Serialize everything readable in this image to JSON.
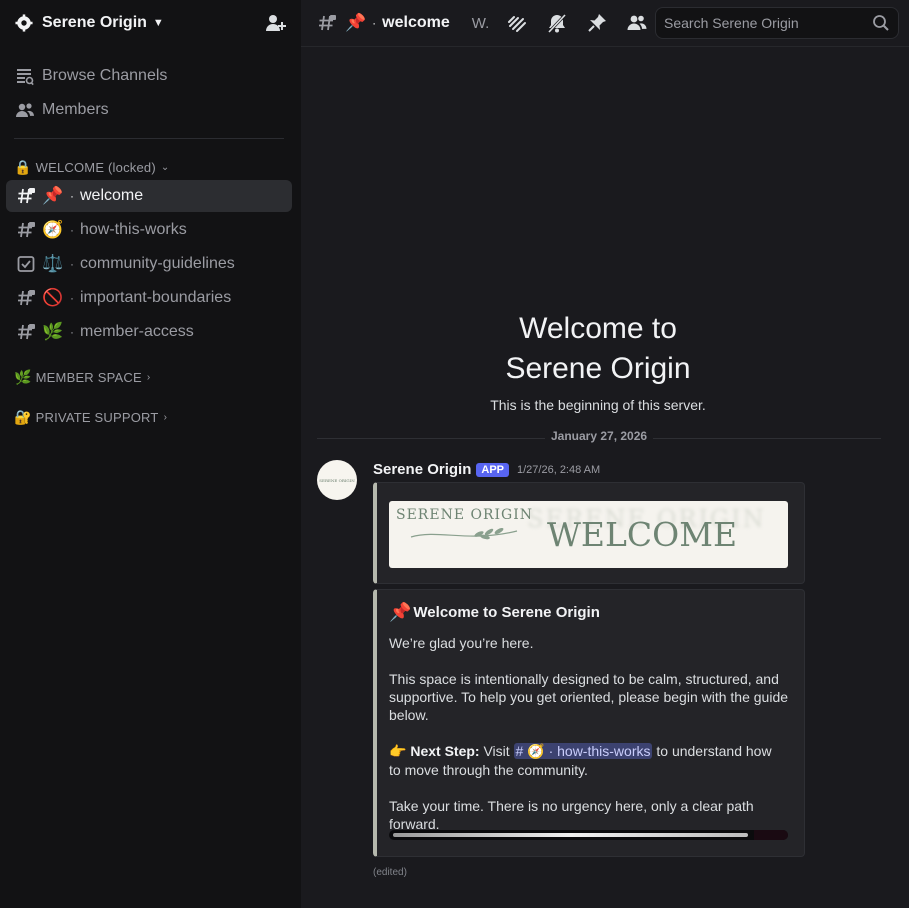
{
  "server": {
    "name": "Serene Origin"
  },
  "sidebar": {
    "nav": [
      {
        "label": "Browse Channels",
        "icon": "browse-channels-icon"
      },
      {
        "label": "Members",
        "icon": "members-icon"
      }
    ],
    "categories": [
      {
        "emoji": "🔒",
        "label": "WELCOME (locked)"
      },
      {
        "emoji": "🌿",
        "label": "MEMBER SPACE"
      },
      {
        "emoji": "🔐",
        "label": "PRIVATE SUPPORT"
      }
    ],
    "channels": [
      {
        "emoji": "📌",
        "name": "welcome",
        "active": true
      },
      {
        "emoji": "🧭",
        "name": "how-this-works"
      },
      {
        "emoji": "⚖️",
        "name": "community-guidelines"
      },
      {
        "emoji": "🚫",
        "name": "important-boundaries"
      },
      {
        "emoji": "🌿",
        "name": "member-access"
      }
    ],
    "separator": "·"
  },
  "topbar": {
    "channel_emoji": "📌",
    "channel_name": "welcome",
    "topic": "W.",
    "search_placeholder": "Search Serene Origin"
  },
  "main": {
    "welcome_line1": "Welcome to",
    "welcome_line2": "Serene Origin",
    "welcome_sub": "This is the beginning of this server.",
    "date": "January 27, 2026",
    "message": {
      "author": "Serene Origin",
      "badge": "APP",
      "time": "1/27/26, 2:48 AM",
      "avatar_text": "SERENE ORIGIN",
      "banner": {
        "brand": "SERENE ORIGIN",
        "ghost": "SERENE ORIGIN",
        "big": "WELCOME"
      },
      "embed": {
        "title_emoji": "📌",
        "title": "Welcome to Serene Origin",
        "line1": "We’re glad you’re here.",
        "para_a": "This space is intentionally designed to be calm, structured, and",
        "para_b": "supportive. To help you get oriented, please begin with the guide",
        "para_c": "below.",
        "next_emoji": "👉",
        "next_label": "Next Step:",
        "next_visit": "Visit",
        "mention_hash": "#",
        "mention_emoji": "🧭",
        "mention_name": "how-this-works",
        "next_rest": "to understand how",
        "next_line2": "to move through the community.",
        "closing": "Take your time. There is no urgency here, only a clear path forward."
      },
      "edited": "(edited)"
    }
  },
  "colors": {
    "accent": "#5865f2",
    "sidebar_bg": "#121214",
    "main_bg": "#1a1a1e",
    "embed_border": "#b5b8ad"
  }
}
